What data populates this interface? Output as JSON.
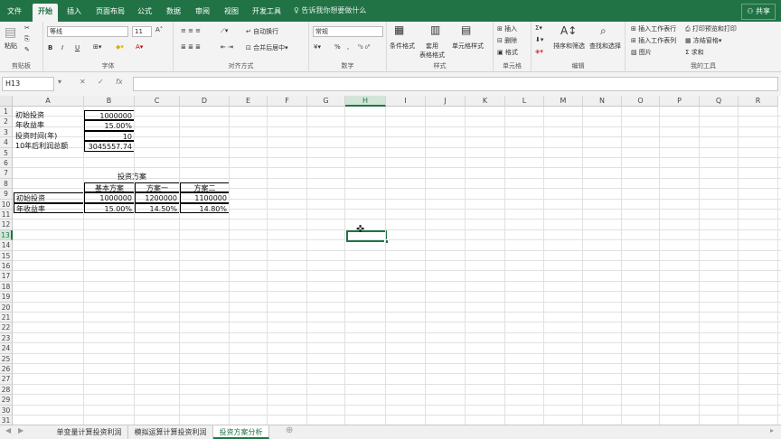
{
  "menu": {
    "tabs": [
      "文件",
      "开始",
      "插入",
      "页面布局",
      "公式",
      "数据",
      "审阅",
      "视图",
      "开发工具"
    ],
    "tell_me": "告诉我你想要做什么",
    "share": "共享"
  },
  "ribbon": {
    "clipboard": {
      "paste": "粘贴",
      "label": "剪贴板"
    },
    "font": {
      "name": "等线",
      "size": "11",
      "bold": "B",
      "italic": "I",
      "underline": "U",
      "label": "字体"
    },
    "alignment": {
      "wrap": "自动换行",
      "merge": "合并后居中",
      "label": "对齐方式"
    },
    "number": {
      "format": "常规",
      "percent": "%",
      "comma": ",",
      "label": "数字"
    },
    "styles": {
      "conditional": "条件格式",
      "table": "套用\n表格格式",
      "cell": "单元格样式",
      "label": "样式"
    },
    "cells": {
      "insert": "插入",
      "delete": "删除",
      "format": "格式",
      "label": "单元格"
    },
    "editing": {
      "sort": "排序和筛选",
      "find": "查找和选择",
      "label": "编辑"
    },
    "mytools": {
      "insert_row": "插入工作表行",
      "insert_col": "插入工作表列",
      "picture": "图片",
      "print_preview": "打印预览和打印",
      "freeze": "冻结窗格",
      "sum": "求和",
      "label": "我的工具"
    }
  },
  "formula_bar": {
    "name_box": "H13",
    "cancel": "✕",
    "confirm": "✓",
    "fx": "fx",
    "content": ""
  },
  "columns": [
    "A",
    "B",
    "C",
    "D",
    "E",
    "F",
    "G",
    "H",
    "I",
    "J",
    "K",
    "L",
    "M",
    "N",
    "O",
    "P",
    "Q",
    "R"
  ],
  "rows": [
    "1",
    "2",
    "3",
    "4",
    "5",
    "6",
    "7",
    "8",
    "9",
    "10",
    "11",
    "12",
    "13",
    "14",
    "15",
    "16",
    "17",
    "18",
    "19",
    "20",
    "21",
    "22",
    "23",
    "24",
    "25",
    "26",
    "27",
    "28",
    "29",
    "30",
    "31"
  ],
  "selected": {
    "col": "H",
    "row": "13"
  },
  "cells": {
    "a1": "初始投资",
    "b1": "1000000",
    "a2": "年收益率",
    "b2": "15.00%",
    "a3": "投资时间(年)",
    "b3": "10",
    "a4": "10年后利润总额",
    "b4": "3045557.74",
    "table_title": "投资方案",
    "hdr_b": "基本方案",
    "hdr_c": "方案一",
    "hdr_d": "方案二",
    "a9": "初始投资",
    "b9": "1000000",
    "c9": "1200000",
    "d9": "1100000",
    "a10": "年收益率",
    "b10": "15.00%",
    "c10": "14.50%",
    "d10": "14.80%"
  },
  "sheet_tabs": [
    "单变量计算投资利润",
    "模拟运算计算投资利润",
    "投资方案分析"
  ],
  "active_sheet": "投资方案分析",
  "colors": {
    "accent": "#217346"
  }
}
